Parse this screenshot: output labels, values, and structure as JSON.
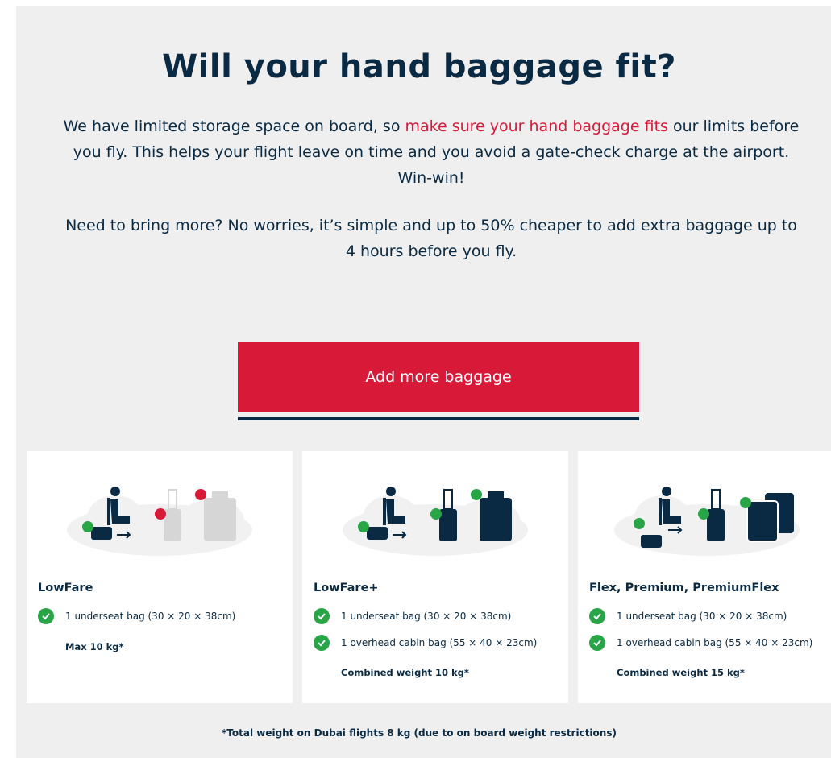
{
  "heading": "Will your hand baggage fit?",
  "intro": {
    "before": "We have limited storage space on board, so ",
    "highlight": "make sure your hand baggage fits",
    "after": " our limits before you fly. This helps your flight leave on time and you avoid a gate-check charge at the airport. Win-win!"
  },
  "more_info": "Need to bring more? No worries, it’s simple and up to 50% cheaper to add extra baggage up to 4 hours before you fly.",
  "cta_label": "Add more baggage",
  "cards": [
    {
      "name": "LowFare",
      "items": [
        "1 underseat bag (30 × 20 × 38cm)"
      ],
      "note": "Max 10 kg*"
    },
    {
      "name": "LowFare+",
      "items": [
        "1 underseat bag (30 × 20 × 38cm)",
        "1 overhead cabin bag (55 × 40 × 23cm)"
      ],
      "note": "Combined weight 10 kg*"
    },
    {
      "name": "Flex, Premium, PremiumFlex",
      "items": [
        "1 underseat bag (30 × 20 × 38cm)",
        "1 overhead cabin bag (55 × 40 × 23cm)"
      ],
      "note": "Combined weight 15 kg*"
    }
  ],
  "footnote": "*Total weight on Dubai flights 8 kg (due to on board weight restrictions)",
  "colors": {
    "navy": "#0a2a43",
    "red": "#d81a38",
    "green": "#27a547",
    "panel": "#efefef"
  }
}
